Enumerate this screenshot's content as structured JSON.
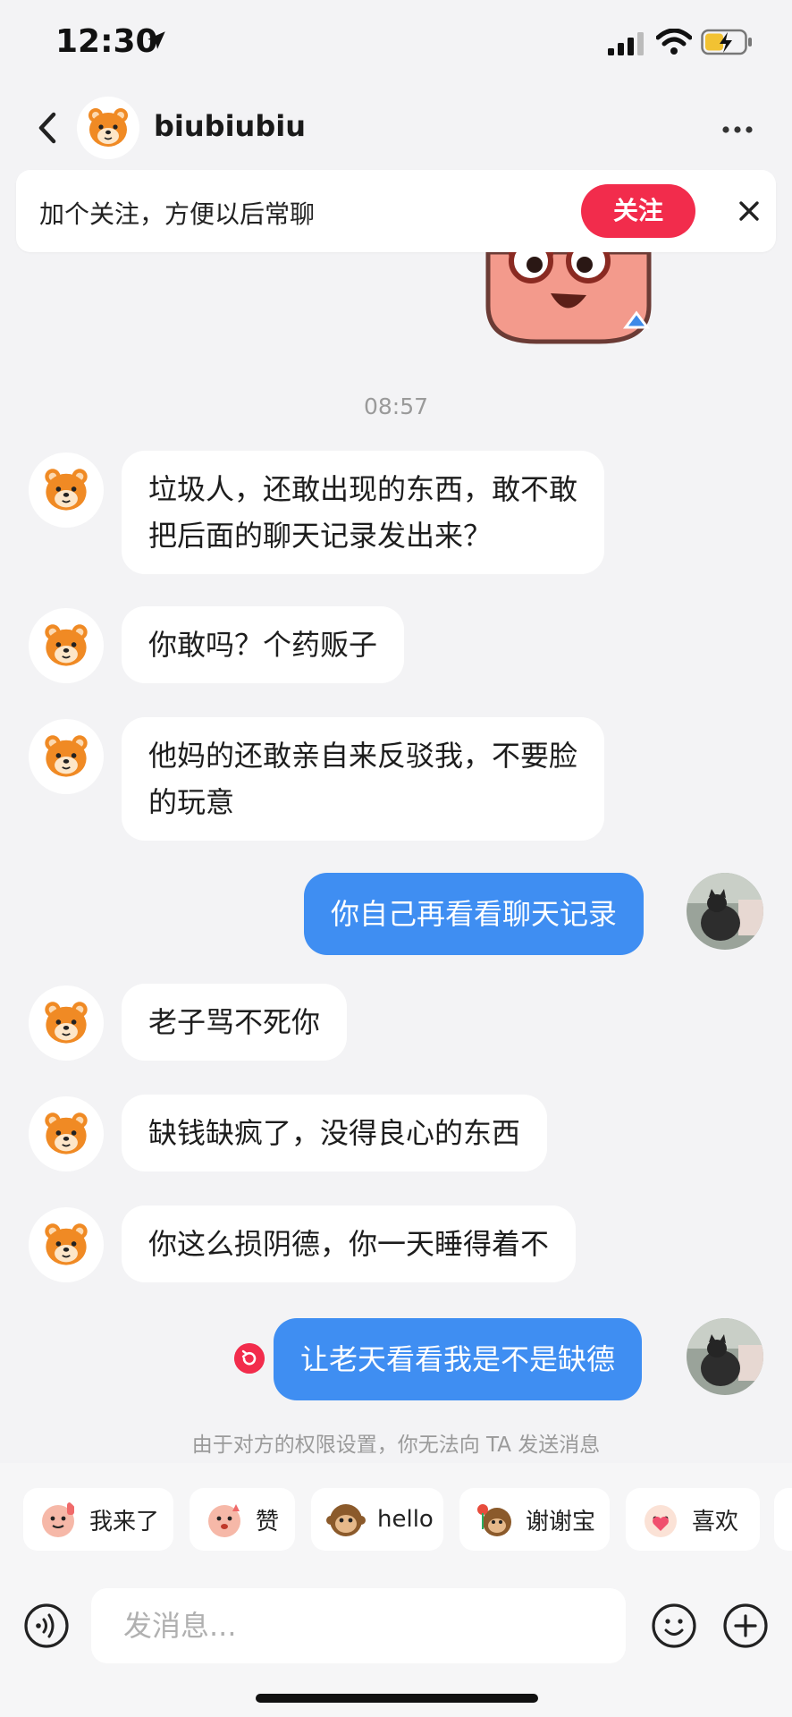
{
  "status_bar": {
    "time": "12:30"
  },
  "header": {
    "name": "biubiubiu"
  },
  "banner": {
    "text": "加个关注，方便以后常聊",
    "follow_label": "关注"
  },
  "timestamp": "08:57",
  "messages": [
    {
      "side": "in",
      "text_lines": [
        "垃圾人，还敢出现的东西，敢不敢",
        "把后面的聊天记录发出来？"
      ]
    },
    {
      "side": "in",
      "text_lines": [
        "你敢吗？个药贩子"
      ]
    },
    {
      "side": "in",
      "text_lines": [
        "他妈的还敢亲自来反驳我，不要脸",
        "的玩意"
      ]
    },
    {
      "side": "out",
      "text_lines": [
        "你自己再看看聊天记录"
      ]
    },
    {
      "side": "in",
      "text_lines": [
        "老子骂不死你"
      ]
    },
    {
      "side": "in",
      "text_lines": [
        "缺钱缺疯了，没得良心的东西"
      ]
    },
    {
      "side": "in",
      "text_lines": [
        "你这么损阴德，你一天睡得着不"
      ]
    },
    {
      "side": "out",
      "text_lines": [
        "让老天看看我是不是缺德"
      ],
      "failed": true
    }
  ],
  "notice": "由于对方的权限设置，你无法向 TA 发送消息",
  "quick_replies": [
    "我来了",
    "赞",
    "hello",
    "谢谢宝",
    "喜欢"
  ],
  "input": {
    "placeholder": "发消息..."
  },
  "colors": {
    "accent": "#3f8ef2",
    "follow_red": "#f22c4c",
    "bg": "#f3f3f5"
  }
}
